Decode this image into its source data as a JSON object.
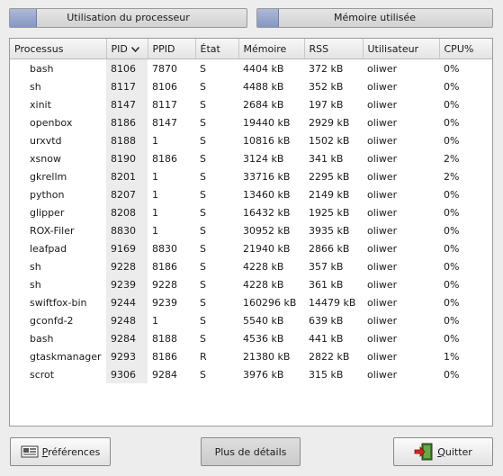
{
  "meters": {
    "cpu_label": "Utilisation du processeur",
    "cpu_fraction": 0.11,
    "mem_label": "Mémoire utilisée",
    "mem_fraction": 0.09
  },
  "table": {
    "columns": [
      "Processus",
      "PID",
      "PPID",
      "État",
      "Mémoire",
      "RSS",
      "Utilisateur",
      "CPU%"
    ],
    "sort_column": "PID",
    "rows": [
      [
        "bash",
        "8106",
        "7870",
        "S",
        "4404 kB",
        "372 kB",
        "oliwer",
        "0%"
      ],
      [
        "sh",
        "8117",
        "8106",
        "S",
        "4488 kB",
        "352 kB",
        "oliwer",
        "0%"
      ],
      [
        "xinit",
        "8147",
        "8117",
        "S",
        "2684 kB",
        "197 kB",
        "oliwer",
        "0%"
      ],
      [
        "openbox",
        "8186",
        "8147",
        "S",
        "19440 kB",
        "2929 kB",
        "oliwer",
        "0%"
      ],
      [
        "urxvtd",
        "8188",
        "1",
        "S",
        "10816 kB",
        "1502 kB",
        "oliwer",
        "0%"
      ],
      [
        "xsnow",
        "8190",
        "8186",
        "S",
        "3124 kB",
        "341 kB",
        "oliwer",
        "2%"
      ],
      [
        "gkrellm",
        "8201",
        "1",
        "S",
        "33716 kB",
        "2295 kB",
        "oliwer",
        "2%"
      ],
      [
        "python",
        "8207",
        "1",
        "S",
        "13460 kB",
        "2149 kB",
        "oliwer",
        "0%"
      ],
      [
        "glipper",
        "8208",
        "1",
        "S",
        "16432 kB",
        "1925 kB",
        "oliwer",
        "0%"
      ],
      [
        "ROX-Filer",
        "8830",
        "1",
        "S",
        "30952 kB",
        "3935 kB",
        "oliwer",
        "0%"
      ],
      [
        "leafpad",
        "9169",
        "8830",
        "S",
        "21940 kB",
        "2866 kB",
        "oliwer",
        "0%"
      ],
      [
        "sh",
        "9228",
        "8186",
        "S",
        "4228 kB",
        "357 kB",
        "oliwer",
        "0%"
      ],
      [
        "sh",
        "9239",
        "9228",
        "S",
        "4228 kB",
        "361 kB",
        "oliwer",
        "0%"
      ],
      [
        "swiftfox-bin",
        "9244",
        "9239",
        "S",
        "160296 kB",
        "14479 kB",
        "oliwer",
        "0%"
      ],
      [
        "gconfd-2",
        "9248",
        "1",
        "S",
        "5540 kB",
        "639 kB",
        "oliwer",
        "0%"
      ],
      [
        "bash",
        "9284",
        "8188",
        "S",
        "4536 kB",
        "441 kB",
        "oliwer",
        "0%"
      ],
      [
        "gtaskmanager",
        "9293",
        "8186",
        "R",
        "21380 kB",
        "2822 kB",
        "oliwer",
        "1%"
      ],
      [
        "scrot",
        "9306",
        "9284",
        "S",
        "3976 kB",
        "315 kB",
        "oliwer",
        "0%"
      ]
    ]
  },
  "buttons": {
    "prefs_first": "P",
    "prefs_rest": "références",
    "details": "Plus de détails",
    "quit_first": "Q",
    "quit_rest": "uitter"
  },
  "icons": {
    "prefs": "preferences-icon",
    "quit": "quit-icon"
  }
}
